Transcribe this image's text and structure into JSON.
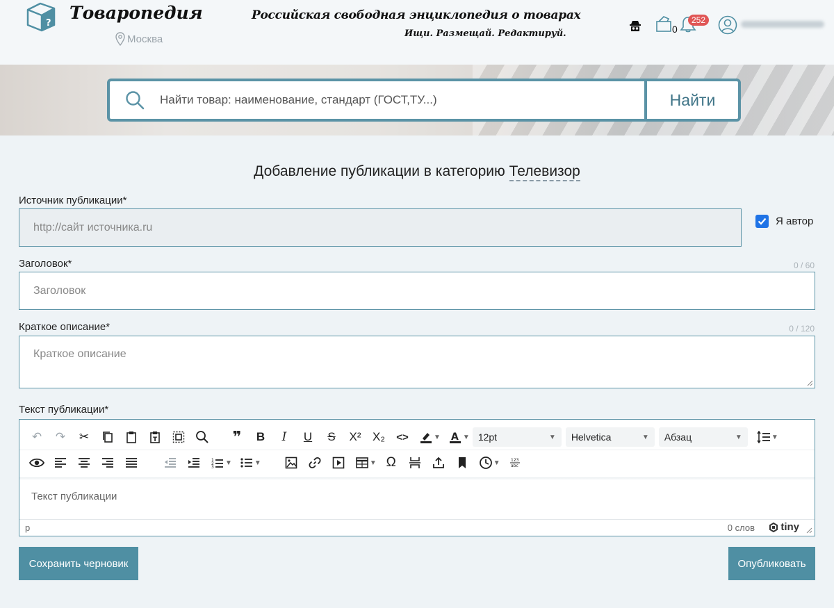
{
  "header": {
    "logo_text": "Товаропедия",
    "city": "Москва",
    "slogan_main": "Российская свободная энциклопедия о товарах",
    "slogan_sub": "Ищи. Размещай. Редактируй.",
    "cart_count": "0",
    "notification_count": "252"
  },
  "search": {
    "placeholder": "Найти товар: наименование, стандарт (ГОСТ,ТУ...)",
    "button_label": "Найти"
  },
  "form": {
    "title_prefix": "Добавление публикации в категорию",
    "category": "Телевизор",
    "source_label": "Источник публикации*",
    "source_placeholder": "http://сайт источника.ru",
    "author_checkbox_label": "Я автор",
    "author_checked": true,
    "title_label": "Заголовок*",
    "title_placeholder": "Заголовок",
    "title_counter": "0 / 60",
    "desc_label": "Краткое описание*",
    "desc_placeholder": "Краткое описание",
    "desc_counter": "0 / 120",
    "text_label": "Текст публикации*",
    "text_placeholder": "Текст публикации"
  },
  "editor": {
    "font_size": "12pt",
    "font_family": "Helvetica",
    "block_format": "Абзац",
    "status_path": "p",
    "word_count": "0 слов",
    "brand": "tiny"
  },
  "actions": {
    "save_draft": "Сохранить черновик",
    "publish": "Опубликовать"
  },
  "colors": {
    "accent": "#4f8fa3",
    "border": "#5b93a6",
    "badge": "#e05656",
    "checkbox": "#1f73e6"
  }
}
